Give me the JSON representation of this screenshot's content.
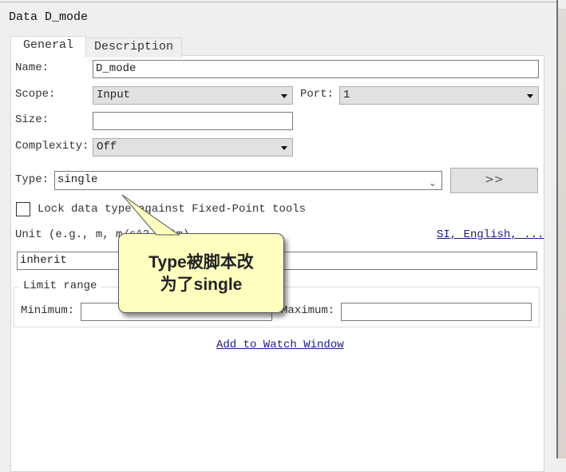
{
  "window": {
    "title": "Data D_mode"
  },
  "tabs": [
    {
      "label": "General",
      "active": true
    },
    {
      "label": "Description",
      "active": false
    }
  ],
  "form": {
    "name": {
      "label": "Name:",
      "value": "D_mode"
    },
    "scope": {
      "label": "Scope:",
      "value": "Input"
    },
    "port": {
      "label": "Port:",
      "value": "1"
    },
    "size": {
      "label": "Size:",
      "value": ""
    },
    "complexity": {
      "label": "Complexity:",
      "value": "Off"
    },
    "type": {
      "label": "Type:",
      "value": "single",
      "assistant_button": ">>"
    },
    "lock_checkbox": {
      "label": "Lock data type against Fixed-Point tools",
      "checked": false
    },
    "unit": {
      "label": "Unit (e.g., m, m/s^2, N*m)",
      "value": "inherit",
      "link": "SI, English, ..."
    },
    "limit_range": {
      "legend": "Limit range",
      "minimum": {
        "label": "Minimum:",
        "value": ""
      },
      "maximum": {
        "label": "Maximum:",
        "value": ""
      }
    },
    "watch_link": "Add to Watch Window"
  },
  "callout": {
    "line1": "Type被脚本改",
    "line2": "为了single",
    "bg_color": "#ffffc0"
  }
}
